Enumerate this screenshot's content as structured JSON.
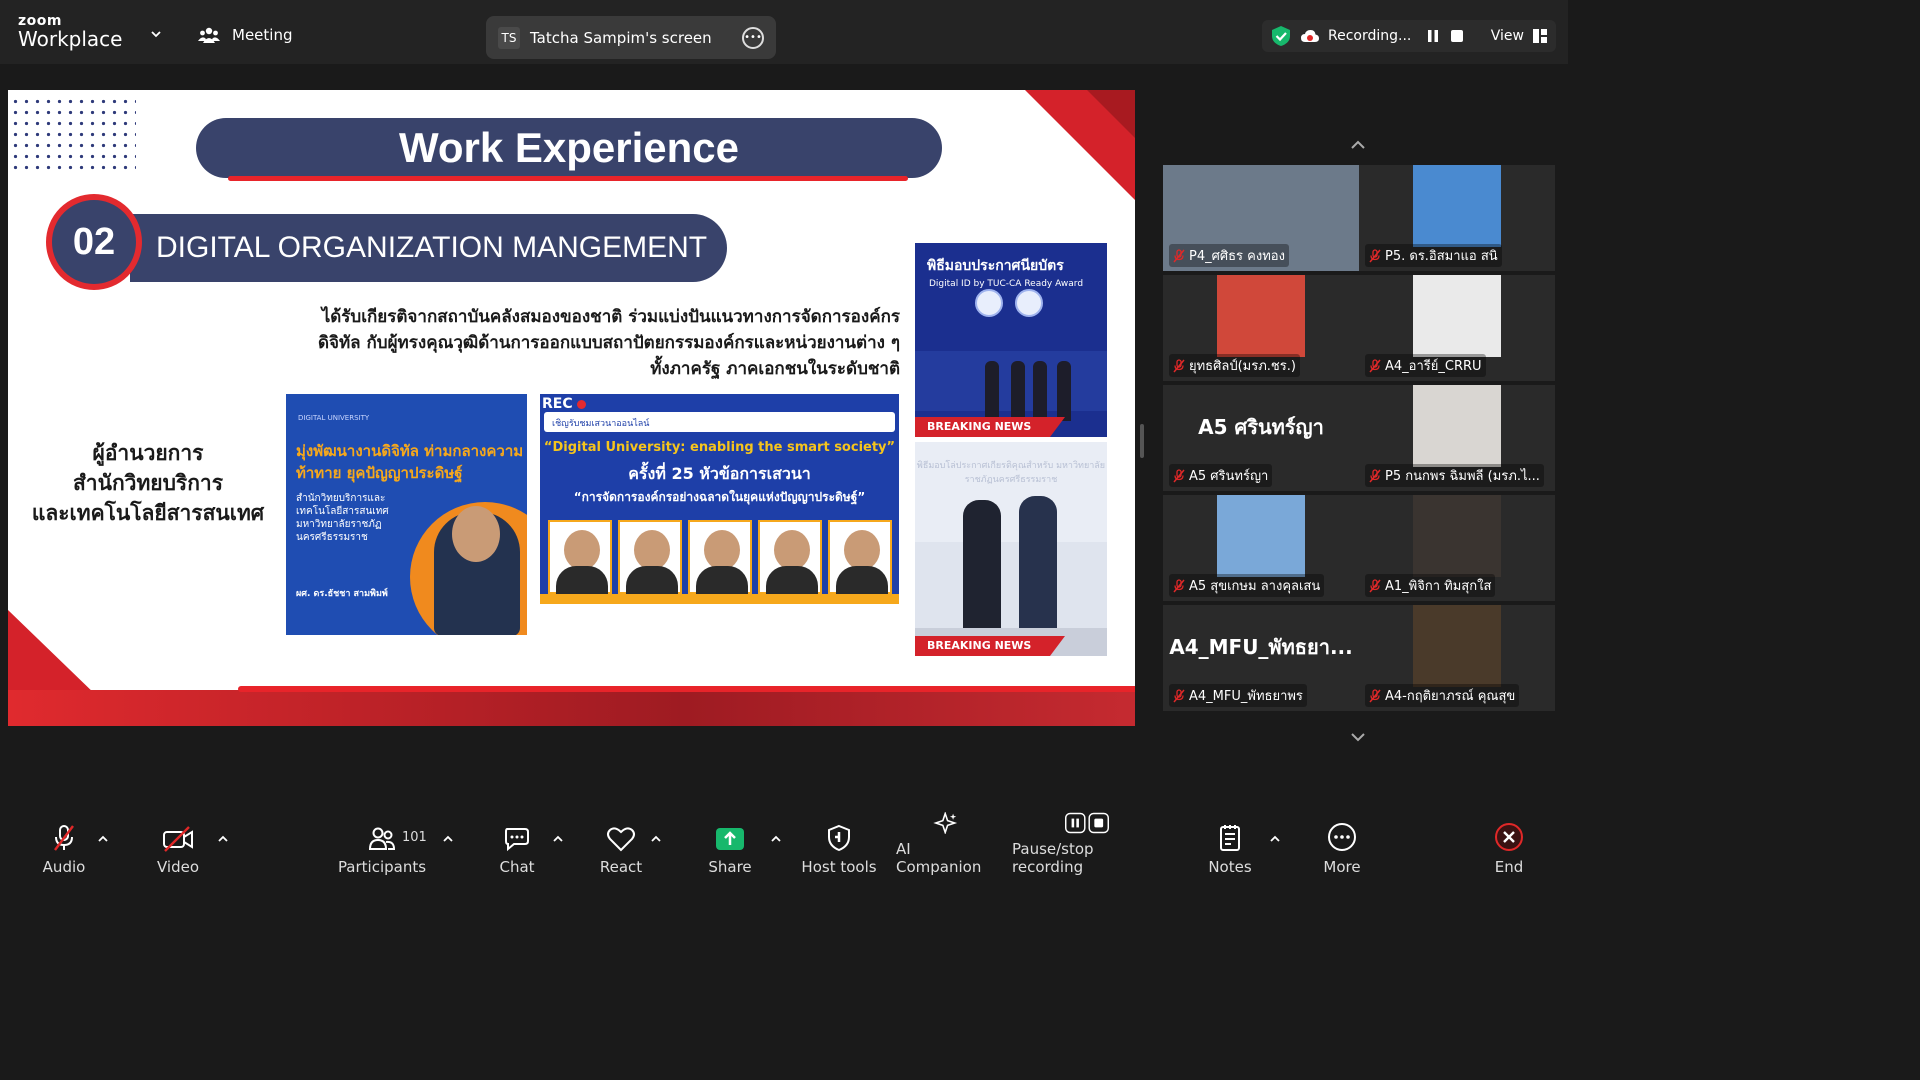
{
  "topbar": {
    "logo_top": "zoom",
    "logo_bottom": "Workplace",
    "meeting_label": "Meeting",
    "share_initials": "TS",
    "share_label": "Tatcha Sampim's screen",
    "recording_label": "Recording...",
    "view_label": "View"
  },
  "slide": {
    "title": "Work  Experience",
    "section_number": "02",
    "section_title": "DIGITAL ORGANIZATION MANGEMENT",
    "description": "ได้รับเกียรติจากสถาบันคลังสมองของชาติ ร่วมแบ่งปันแนวทางการจัดการองค์กรดิจิทัล กับผู้ทรงคุณวุฒิด้านการออกแบบสถาปัตยกรรมองค์กรและหน่วยงานต่าง ๆ ทั้งภาครัฐ ภาคเอกชนในระดับชาติ",
    "role_line1": "ผู้อำนวยการ",
    "role_line2": "สำนักวิทยบริการ",
    "role_line3": "และเทคโนโลยีสารสนเทศ"
  },
  "poster_left": {
    "header": "DIGITAL UNIVERSITY",
    "headline": "มุ่งพัฒนางานดิจิทัล ท่ามกลางความท้าทาย ยุคปัญญาประดิษฐ์",
    "sub": "สำนักวิทยบริการและเทคโนโลยีสารสนเทศ มหาวิทยาลัยราชภัฏนครศรีธรรมราช",
    "name": "ผศ. ดร.ธัชชา สามพิมพ์"
  },
  "poster_mid": {
    "rec": "REC",
    "banner": "เชิญรับชมเสวนาออนไลน์",
    "line1": "“Digital University: enabling the smart society”",
    "line2": "ครั้งที่ 25 หัวข้อการเสวนา",
    "line3": "“การจัดการองค์กรอย่างฉลาดในยุคแห่งปัญญาประดิษฐ์”"
  },
  "poster_right_top": {
    "title": "พิธีมอบประกาศนียบัตร",
    "subtitle": "Digital ID by TUC-CA Ready Award",
    "breaking": "BREAKING NEWS"
  },
  "poster_right_bottom": {
    "wall_text": "พิธีมอบโล่ประกาศเกียรติคุณสำหรับ มหาวิทยาลัยราชภัฏนครศรีธรรมราช",
    "breaking": "BREAKING NEWS"
  },
  "participants": [
    {
      "name": "P4_ศศิธร คงทอง",
      "big": ""
    },
    {
      "name": "P5. ดร.อิสมาแอ สนิ",
      "big": ""
    },
    {
      "name": "ยุทธศิลป์(มรภ.ชร.)",
      "big": ""
    },
    {
      "name": "A4_อารีย์_CRRU",
      "big": ""
    },
    {
      "name": "A5 ศรินทร์ญา",
      "big": "A5 ศรินทร์ญา"
    },
    {
      "name": "P5 กนกพร ฉิมพลี (มรภ.ไ...",
      "big": ""
    },
    {
      "name": "A5 สุขเกษม ลางคุลเสน",
      "big": ""
    },
    {
      "name": "A1_พิจิกา ทิมสุกใส",
      "big": ""
    },
    {
      "name": "A4_MFU_พัทธยาพร",
      "big": "A4_MFU_พัทธยา..."
    },
    {
      "name": "A4-กฤติยาภรณ์ คุณสุข",
      "big": ""
    }
  ],
  "toolbar": {
    "audio": "Audio",
    "video": "Video",
    "participants": "Participants",
    "participant_count": "101",
    "chat": "Chat",
    "react": "React",
    "share": "Share",
    "host_tools": "Host tools",
    "ai_companion": "AI Companion",
    "pause_stop": "Pause/stop recording",
    "notes": "Notes",
    "more": "More",
    "end": "End"
  },
  "colors": {
    "navy": "#39436b",
    "red": "#e32a2f",
    "share_green": "#17b86c",
    "muted_red": "#e02828"
  }
}
